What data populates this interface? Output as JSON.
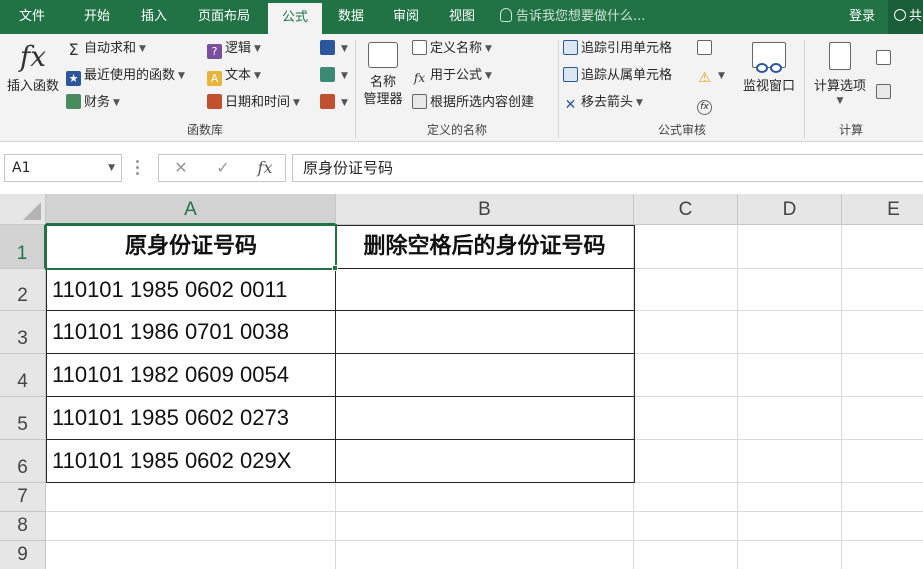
{
  "tabs": [
    {
      "label": "文件",
      "active": false
    },
    {
      "label": "开始",
      "active": false
    },
    {
      "label": "插入",
      "active": false
    },
    {
      "label": "页面布局",
      "active": false
    },
    {
      "label": "公式",
      "active": true
    },
    {
      "label": "数据",
      "active": false
    },
    {
      "label": "审阅",
      "active": false
    },
    {
      "label": "视图",
      "active": false
    }
  ],
  "tell_me": "告诉我您想要做什么...",
  "login": "登录",
  "share": "共享",
  "ribbon": {
    "insert_function": {
      "symbol": "fx",
      "label": "插入函数"
    },
    "autosum": "自动求和",
    "recent": "最近使用的函数",
    "financial": "财务",
    "logical": "逻辑",
    "text": "文本",
    "datetime": "日期和时间",
    "library_label": "函数库",
    "name_manager": {
      "line1": "名称",
      "line2": "管理器"
    },
    "define_name": "定义名称",
    "use_in_formula": "用于公式",
    "create_from_selection": "根据所选内容创建",
    "names_label": "定义的名称",
    "trace_precedents": "追踪引用单元格",
    "trace_dependents": "追踪从属单元格",
    "remove_arrows": "移去箭头",
    "watch_window": "监视窗口",
    "auditing_label": "公式审核",
    "calc_options": "计算选项",
    "calc_label": "计算"
  },
  "formula_bar": {
    "name_box": "A1",
    "cancel": "✕",
    "enter": "✓",
    "fx": "fx",
    "content": "原身份证号码"
  },
  "columns": [
    "A",
    "B",
    "C",
    "D",
    "E"
  ],
  "rows": [
    "1",
    "2",
    "3",
    "4",
    "5",
    "6",
    "7",
    "8",
    "9"
  ],
  "table": {
    "headers": [
      "原身份证号码",
      "删除空格后的身份证号码"
    ],
    "values": [
      "110101 1985 0602 0011",
      "110101 1986 0701 0038",
      "110101 1982 0609 0054",
      "110101 1985 0602 0273",
      "110101 1985 0602 029X"
    ]
  },
  "colors": {
    "accent": "#217346",
    "ribbon_bg": "#f3f3f3",
    "header_bg": "#e6e6e6",
    "gridline": "#dadada"
  }
}
